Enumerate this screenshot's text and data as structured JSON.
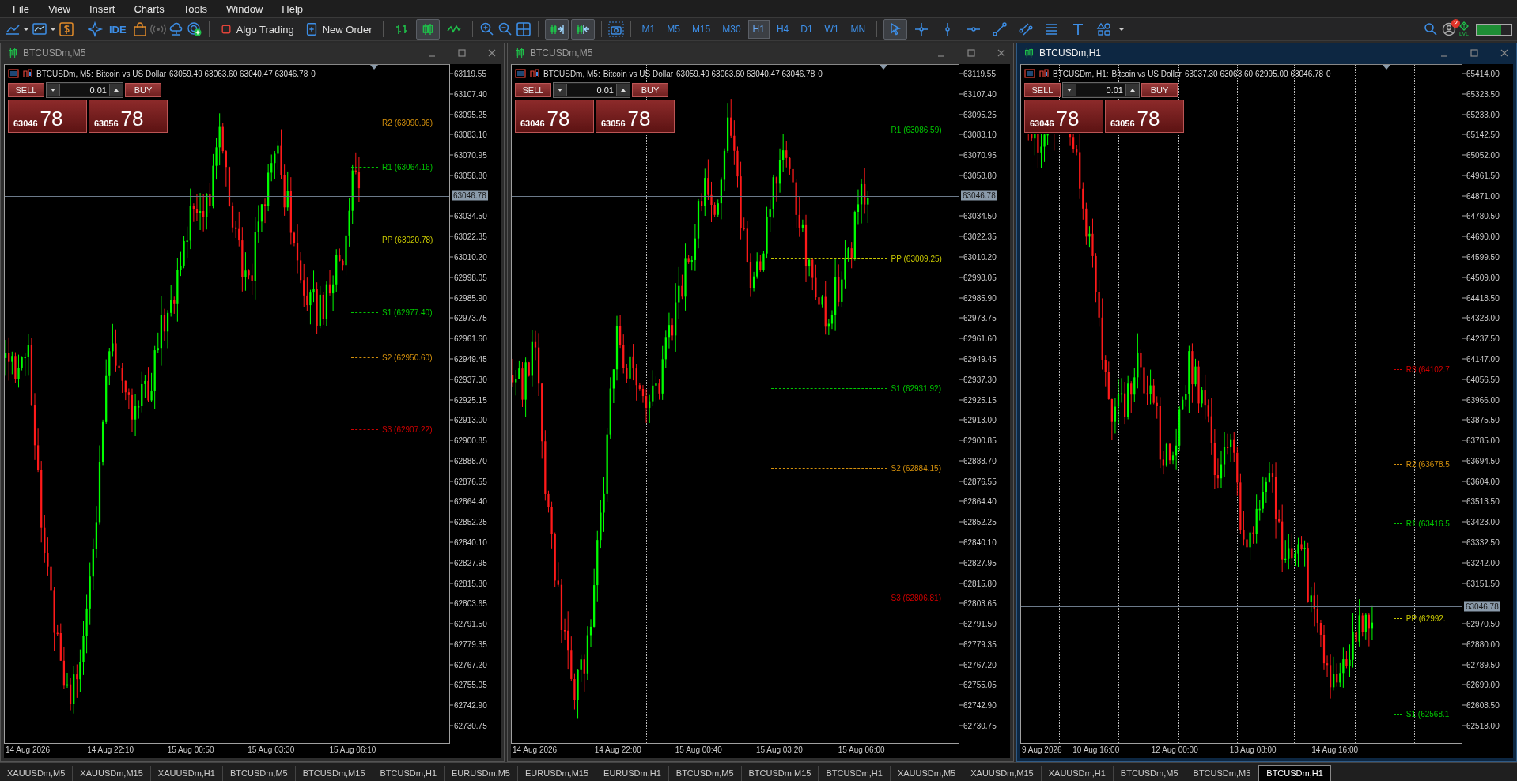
{
  "menu": [
    "File",
    "View",
    "Insert",
    "Charts",
    "Tools",
    "Window",
    "Help"
  ],
  "toolbar": {
    "ide": "IDE",
    "algo_trading": "Algo Trading",
    "new_order": "New Order",
    "chart_types": [
      {
        "selected": false
      },
      {
        "selected": true
      },
      {
        "selected": false
      }
    ],
    "chart_shifts": [
      {
        "selected": true
      },
      {
        "selected": true
      }
    ],
    "timeframes": [
      {
        "label": "M1",
        "selected": false
      },
      {
        "label": "M5",
        "selected": false
      },
      {
        "label": "M15",
        "selected": false
      },
      {
        "label": "M30",
        "selected": false
      },
      {
        "label": "H1",
        "selected": true
      },
      {
        "label": "H4",
        "selected": false
      },
      {
        "label": "D1",
        "selected": false
      },
      {
        "label": "W1",
        "selected": false
      },
      {
        "label": "MN",
        "selected": false
      }
    ],
    "tools": [
      {
        "selected": true
      },
      {
        "selected": false
      },
      {
        "selected": false
      },
      {
        "selected": false
      },
      {
        "selected": false
      },
      {
        "selected": false
      },
      {
        "selected": false
      },
      {
        "selected": false
      },
      {
        "selected": false
      }
    ],
    "notification_count": "2",
    "level_label": "LVL"
  },
  "windows": [
    {
      "title": "BTCUSDm,M5",
      "active": false,
      "symbol": "BTCUSDm, M5:",
      "description": "Bitcoin vs US Dollar",
      "ohlc": "63059.49 63063.60 63040.47 63046.78",
      "volume": "0",
      "trade": {
        "sell": "SELL",
        "buy": "BUY",
        "lot": "0.01",
        "bid_main": "63046",
        "bid_pips": "78",
        "ask_main": "63056",
        "ask_pips": "78"
      },
      "price_ticks": [
        "63119.55",
        "63107.40",
        "63095.25",
        "63083.10",
        "63070.95",
        "63058.80",
        "63034.50",
        "63022.35",
        "63010.20",
        "62998.05",
        "62985.90",
        "62973.75",
        "62961.60",
        "62949.45",
        "62937.30",
        "62925.15",
        "62913.00",
        "62900.85",
        "62888.70",
        "62876.55",
        "62864.40",
        "62852.25",
        "62840.10",
        "62827.95",
        "62815.80",
        "62803.65",
        "62791.50",
        "62779.35",
        "62767.20",
        "62755.05",
        "62742.90",
        "62730.75"
      ],
      "current_price": "63046.78",
      "pivots": [
        {
          "label": "R2 (63090.96)",
          "color": "#d4900c"
        },
        {
          "label": "R1 (63064.16)",
          "color": "#00c800"
        },
        {
          "label": "PP (63020.78)",
          "color": "#c8c800"
        },
        {
          "label": "S1 (62977.40)",
          "color": "#00c800"
        },
        {
          "label": "S2 (62950.60)",
          "color": "#d4900c"
        },
        {
          "label": "S3 (62907.22)",
          "color": "#d00000"
        }
      ],
      "time_labels": [
        "14 Aug 2026",
        "14 Aug 22:10",
        "15 Aug 00:50",
        "15 Aug 03:30",
        "15 Aug 06:10"
      ]
    },
    {
      "title": "BTCUSDm,M5",
      "active": false,
      "symbol": "BTCUSDm, M5:",
      "description": "Bitcoin vs US Dollar",
      "ohlc": "63059.49 63063.60 63040.47 63046.78",
      "volume": "0",
      "trade": {
        "sell": "SELL",
        "buy": "BUY",
        "lot": "0.01",
        "bid_main": "63046",
        "bid_pips": "78",
        "ask_main": "63056",
        "ask_pips": "78"
      },
      "price_ticks": [
        "63119.55",
        "63107.40",
        "63095.25",
        "63083.10",
        "63070.95",
        "63058.80",
        "63034.50",
        "63022.35",
        "63010.20",
        "62998.05",
        "62985.90",
        "62973.75",
        "62961.60",
        "62949.45",
        "62937.30",
        "62925.15",
        "62913.00",
        "62900.85",
        "62888.70",
        "62876.55",
        "62864.40",
        "62852.25",
        "62840.10",
        "62827.95",
        "62815.80",
        "62803.65",
        "62791.50",
        "62779.35",
        "62767.20",
        "62755.05",
        "62742.90",
        "62730.75"
      ],
      "current_price": "63046.78",
      "pivots": [
        {
          "label": "R1 (63086.59)",
          "color": "#00c800"
        },
        {
          "label": "PP (63009.25)",
          "color": "#c8c800"
        },
        {
          "label": "S1 (62931.92)",
          "color": "#00c800"
        },
        {
          "label": "S2 (62884.15)",
          "color": "#d4900c"
        },
        {
          "label": "S3 (62806.81)",
          "color": "#d00000"
        }
      ],
      "time_labels": [
        "14 Aug 2026",
        "14 Aug 22:00",
        "15 Aug 00:40",
        "15 Aug 03:20",
        "15 Aug 06:00"
      ]
    },
    {
      "title": "BTCUSDm,H1",
      "active": true,
      "symbol": "BTCUSDm, H1:",
      "description": "Bitcoin vs US Dollar",
      "ohlc": "63037.30 63063.60 62995.00 63046.78",
      "volume": "0",
      "trade": {
        "sell": "SELL",
        "buy": "BUY",
        "lot": "0.01",
        "bid_main": "63046",
        "bid_pips": "78",
        "ask_main": "63056",
        "ask_pips": "78"
      },
      "price_ticks": [
        "65414.00",
        "65323.50",
        "65233.00",
        "65142.50",
        "65052.00",
        "64961.50",
        "64871.00",
        "64780.50",
        "64690.00",
        "64599.50",
        "64509.00",
        "64418.50",
        "64328.00",
        "64237.50",
        "64147.00",
        "64056.50",
        "63966.00",
        "63875.50",
        "63785.00",
        "63694.50",
        "63604.00",
        "63513.50",
        "63423.00",
        "63332.50",
        "63242.00",
        "63151.50",
        "62970.50",
        "62880.00",
        "62789.50",
        "62699.00",
        "62608.50",
        "62518.00"
      ],
      "current_price": "63046.78",
      "pivots": [
        {
          "label": "R3 (64102.7",
          "color": "#d00000"
        },
        {
          "label": "R2 (63678.5",
          "color": "#d4900c"
        },
        {
          "label": "R1 (63416.5",
          "color": "#00c800"
        },
        {
          "label": "PP (62992.",
          "color": "#c8c800"
        },
        {
          "label": "S1 (62568.1",
          "color": "#00c800"
        }
      ],
      "time_labels": [
        "9 Aug 2026",
        "10 Aug 16:00",
        "12 Aug 00:00",
        "13 Aug 08:00",
        "14 Aug 16:00"
      ]
    }
  ],
  "tabs": [
    {
      "label": "XAUUSDm,M5",
      "selected": false
    },
    {
      "label": "XAUUSDm,M15",
      "selected": false
    },
    {
      "label": "XAUUSDm,H1",
      "selected": false
    },
    {
      "label": "BTCUSDm,M5",
      "selected": false
    },
    {
      "label": "BTCUSDm,M15",
      "selected": false
    },
    {
      "label": "BTCUSDm,H1",
      "selected": false
    },
    {
      "label": "EURUSDm,M5",
      "selected": false
    },
    {
      "label": "EURUSDm,M15",
      "selected": false
    },
    {
      "label": "EURUSDm,H1",
      "selected": false
    },
    {
      "label": "BTCUSDm,M5",
      "selected": false
    },
    {
      "label": "BTCUSDm,M15",
      "selected": false
    },
    {
      "label": "BTCUSDm,H1",
      "selected": false
    },
    {
      "label": "XAUUSDm,M5",
      "selected": false
    },
    {
      "label": "XAUUSDm,M15",
      "selected": false
    },
    {
      "label": "XAUUSDm,H1",
      "selected": false
    },
    {
      "label": "BTCUSDm,M5",
      "selected": false
    },
    {
      "label": "BTCUSDm,M5",
      "selected": false
    },
    {
      "label": "BTCUSDm,H1",
      "selected": true
    }
  ]
}
